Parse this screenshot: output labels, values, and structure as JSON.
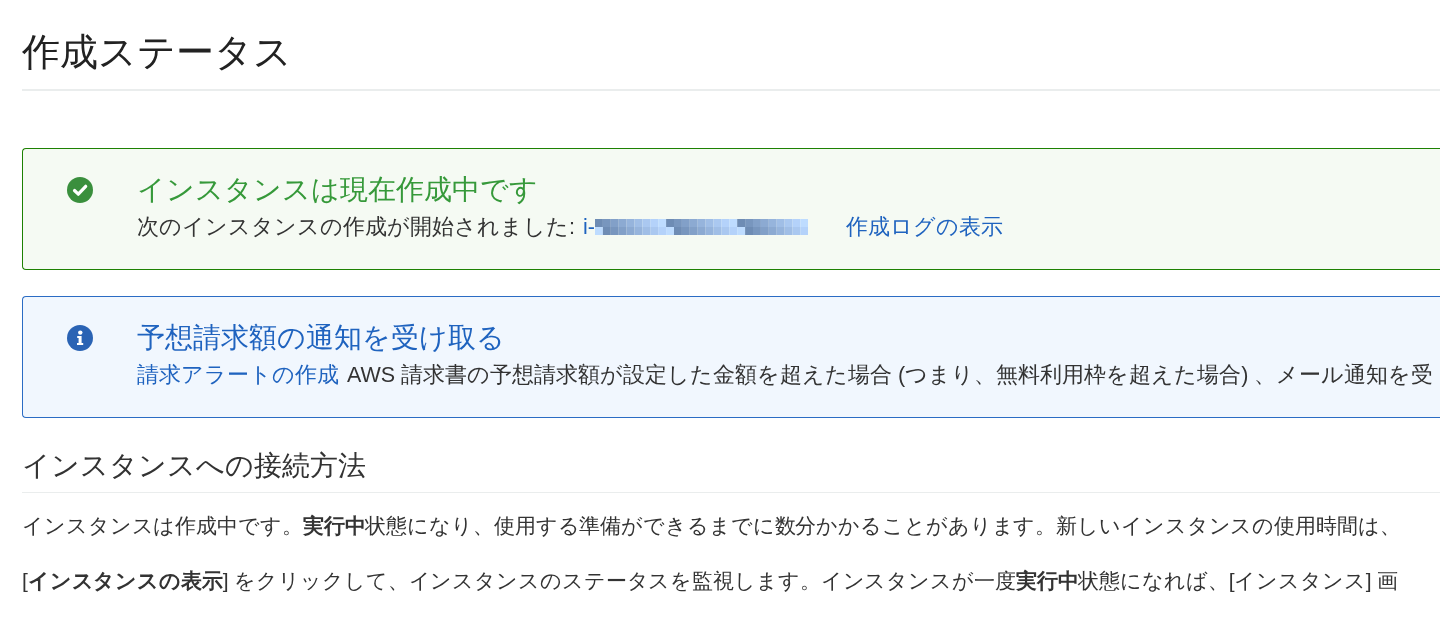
{
  "page_title": "作成ステータス",
  "alerts": [
    {
      "kind": "success",
      "title": "インスタンスは現在作成中です",
      "parts": [
        {
          "kind": "text",
          "text": "次のインスタンスの作成が開始されました:"
        },
        {
          "kind": "link",
          "text": "i-",
          "pixelated": true
        },
        {
          "kind": "link",
          "text": "作成ログの表示"
        }
      ]
    },
    {
      "kind": "info",
      "title": "予想請求額の通知を受け取る",
      "parts": [
        {
          "kind": "link",
          "text": "請求アラートの作成"
        },
        {
          "kind": "text",
          "text": "AWS 請求書の予想請求額が設定した金額を超えた場合 (つまり、無料利用枠を超えた場合) 、メール通知を受"
        }
      ]
    }
  ],
  "section": {
    "heading": "インスタンスへの接続方法",
    "paragraphs": [
      "インスタンスは作成中です。**実行中**状態になり、使用する準備ができるまでに数分かかることがあります。新しいインスタンスの使用時間は、",
      "[**インスタンスの表示**] をクリックして、インスタンスのステータスを監視します。インスタンスが一度**実行中**状態になれば、[インスタンス] 画"
    ]
  }
}
